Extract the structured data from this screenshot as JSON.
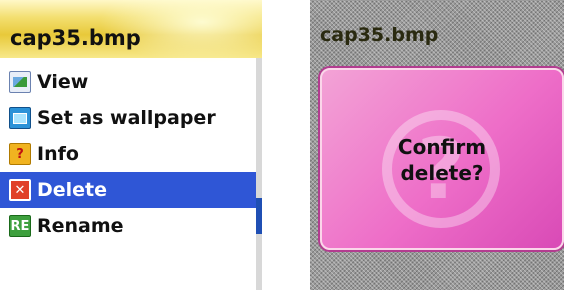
{
  "left_screen": {
    "title": "cap35.bmp",
    "menu": [
      {
        "label": "View",
        "icon": "image-icon",
        "glyph": ""
      },
      {
        "label": "Set as wallpaper",
        "icon": "wallpaper-icon",
        "glyph": ""
      },
      {
        "label": "Info",
        "icon": "info-icon",
        "glyph": "?"
      },
      {
        "label": "Delete",
        "icon": "delete-icon",
        "glyph": "✕",
        "selected": true
      },
      {
        "label": "Rename",
        "icon": "rename-icon",
        "glyph": "RE"
      }
    ]
  },
  "right_screen": {
    "title": "cap35.bmp",
    "dialog": {
      "line1": "Confirm",
      "line2": "delete?",
      "icon": "question-icon",
      "glyph": "?"
    }
  },
  "colors": {
    "selection": "#2f56d6",
    "title_bar": "#e8c93a",
    "dialog_pink": "#ee6ec8"
  }
}
